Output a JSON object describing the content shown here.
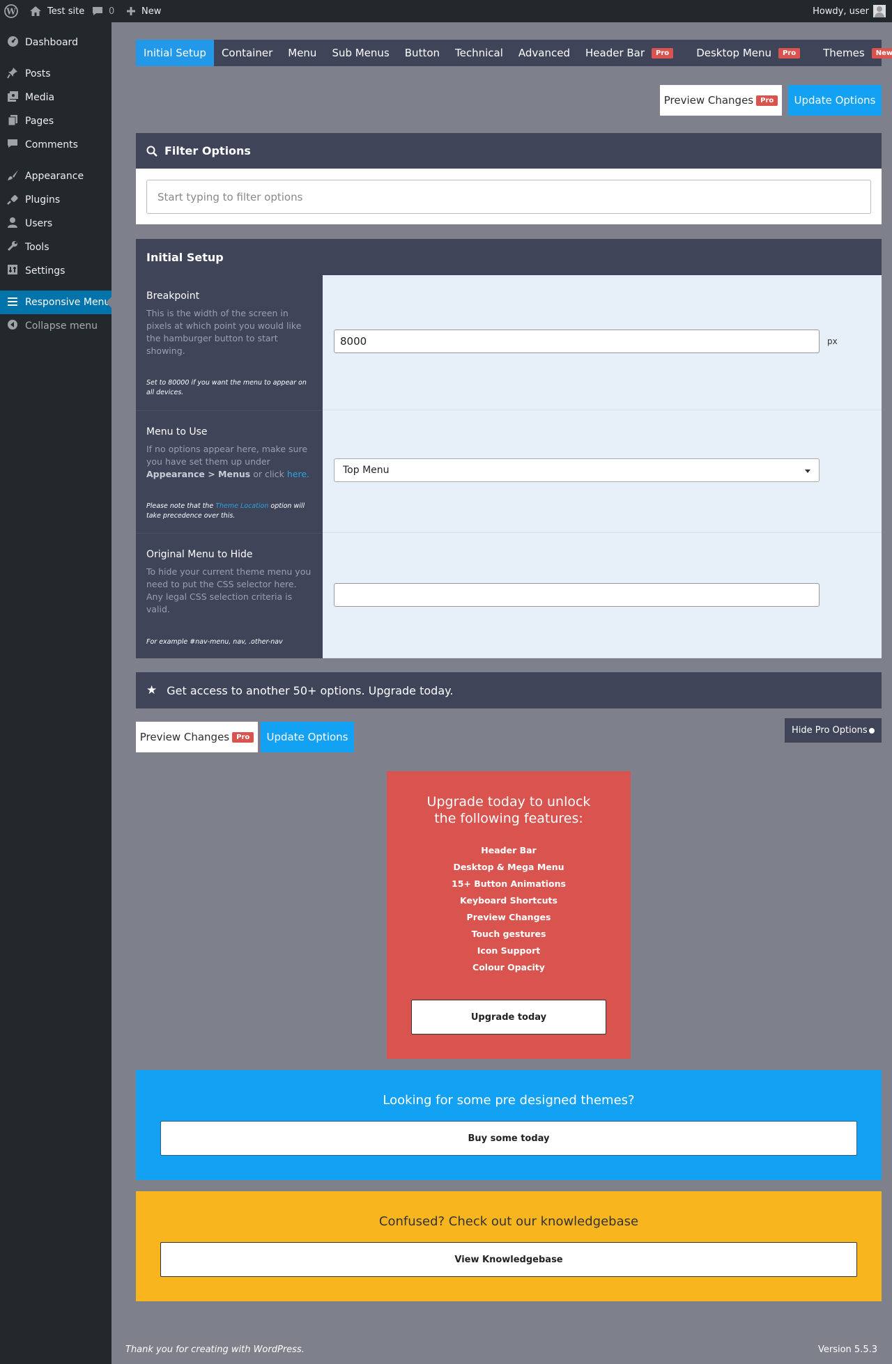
{
  "adminbar": {
    "site_name": "Test site",
    "comments_count": "0",
    "new_label": "New",
    "howdy": "Howdy, user"
  },
  "sidebar": {
    "items": [
      {
        "label": "Dashboard",
        "icon": "dashboard-icon"
      },
      {
        "label": "Posts",
        "icon": "pushpin-icon"
      },
      {
        "label": "Media",
        "icon": "media-icon"
      },
      {
        "label": "Pages",
        "icon": "pages-icon"
      },
      {
        "label": "Comments",
        "icon": "comment-icon"
      },
      {
        "label": "Appearance",
        "icon": "brush-icon"
      },
      {
        "label": "Plugins",
        "icon": "plug-icon"
      },
      {
        "label": "Users",
        "icon": "user-icon"
      },
      {
        "label": "Tools",
        "icon": "wrench-icon"
      },
      {
        "label": "Settings",
        "icon": "settings-icon"
      },
      {
        "label": "Responsive Menu",
        "icon": "hamburger-icon"
      },
      {
        "label": "Collapse menu",
        "icon": "collapse-icon"
      }
    ]
  },
  "tabs": [
    {
      "label": "Initial Setup",
      "badge": ""
    },
    {
      "label": "Container",
      "badge": ""
    },
    {
      "label": "Menu",
      "badge": ""
    },
    {
      "label": "Sub Menus",
      "badge": ""
    },
    {
      "label": "Button",
      "badge": ""
    },
    {
      "label": "Technical",
      "badge": ""
    },
    {
      "label": "Advanced",
      "badge": ""
    },
    {
      "label": "Header Bar",
      "badge": "Pro"
    },
    {
      "label": "Desktop Menu",
      "badge": "Pro"
    },
    {
      "label": "Themes",
      "badge": "New"
    }
  ],
  "actions": {
    "preview_label": "Preview Changes",
    "pro_badge": "Pro",
    "update_label": "Update Options"
  },
  "filter": {
    "title": "Filter Options",
    "placeholder": "Start typing to filter options"
  },
  "section": {
    "title": "Initial Setup",
    "breakpoint": {
      "title": "Breakpoint",
      "desc": "This is the width of the screen in pixels at which point you would like the hamburger button to start showing.",
      "note": "Set to 80000 if you want the menu to appear on all devices.",
      "value": "8000",
      "unit": "px"
    },
    "menu_to_use": {
      "title": "Menu to Use",
      "desc_1": "If no options appear here, make sure you have set them up under",
      "desc_bold": "Appearance > Menus",
      "desc_2": "or click",
      "desc_link": "here.",
      "note_1": "Please note that the",
      "note_link": "Theme Location",
      "note_2": "option will take precedence over this.",
      "selected": "Top Menu"
    },
    "original_hide": {
      "title": "Original Menu to Hide",
      "desc": "To hide your current theme menu you need to put the CSS selector here. Any legal CSS selection criteria is valid.",
      "note": "For example #nav-menu, nav, .other-nav",
      "value": ""
    }
  },
  "promo_bar": {
    "text": "Get access to another 50+ options. Upgrade today."
  },
  "hide_pro_label": "Hide Pro Options",
  "upgrade_card": {
    "title": "Upgrade today to unlock the following features:",
    "features": [
      "Header Bar",
      "Desktop & Mega Menu",
      "15+ Button Animations",
      "Keyboard Shortcuts",
      "Preview Changes",
      "Touch gestures",
      "Icon Support",
      "Colour Opacity"
    ],
    "button": "Upgrade today"
  },
  "themes_band": {
    "title": "Looking for some pre designed themes?",
    "button": "Buy some today"
  },
  "kb_band": {
    "title": "Confused? Check out our knowledgebase",
    "button": "View Knowledgebase"
  },
  "footer": {
    "thanks": "Thank you for creating with WordPress.",
    "version": "Version 5.5.3"
  },
  "colors": {
    "accent_blue": "#13a1f3",
    "panel_dark": "#3f4458",
    "pro_red": "#d9534f",
    "kb_yellow": "#f9b51d"
  }
}
